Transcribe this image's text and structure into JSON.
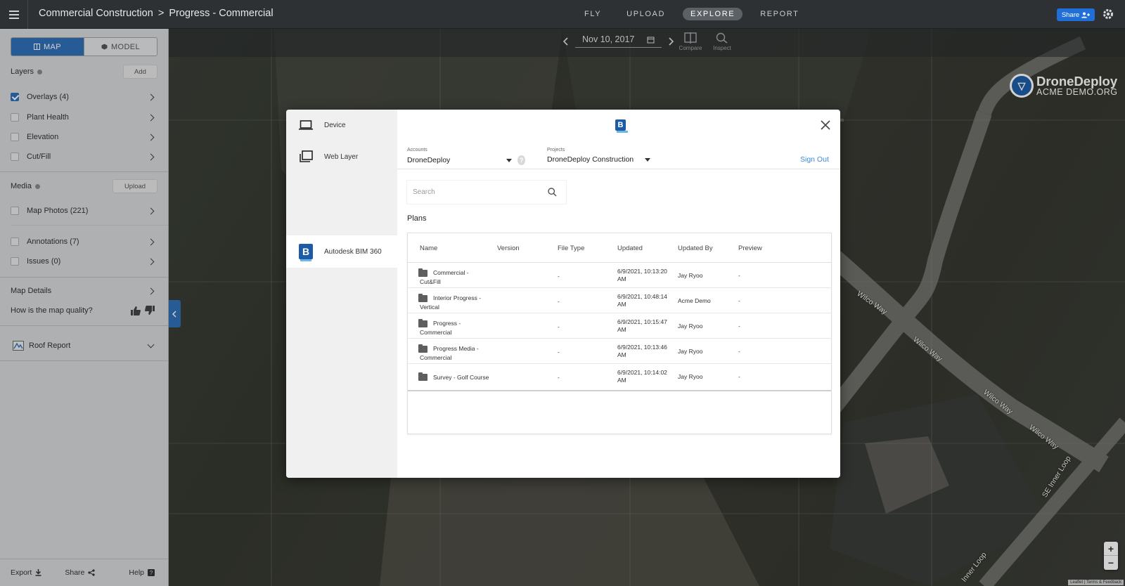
{
  "topbar": {
    "breadcrumb_project": "Commercial Construction",
    "breadcrumb_sep": ">",
    "breadcrumb_map": "Progress - Commercial",
    "tabs": [
      {
        "label": "FLY",
        "active": false
      },
      {
        "label": "UPLOAD",
        "active": false
      },
      {
        "label": "EXPLORE",
        "active": true
      },
      {
        "label": "REPORT",
        "active": false
      }
    ],
    "share_label": "Share",
    "settings_icon": "gear-icon"
  },
  "map": {
    "date": "Nov 10, 2017",
    "tools": [
      {
        "label": "Compare",
        "icon": "compare-icon"
      },
      {
        "label": "Inspect",
        "icon": "inspect-icon"
      }
    ],
    "logo_line1": "DroneDeploy",
    "logo_line2": "ACME DEMO.ORG",
    "road_labels": [
      "Wilco Way",
      "Wilco Way",
      "Wilco Way",
      "Wilco Way",
      "SE Inner Loop",
      "Inner Loop"
    ],
    "zoom_in": "+",
    "zoom_out": "−",
    "attribution": "Leaflet | Terms & Feedback"
  },
  "sidebar": {
    "mode_map": "MAP",
    "mode_model": "MODEL",
    "layers_title": "Layers",
    "layers_add": "Add",
    "layers": [
      {
        "label": "Overlays (4)",
        "checked": true
      },
      {
        "label": "Plant Health",
        "checked": false
      },
      {
        "label": "Elevation",
        "checked": false
      },
      {
        "label": "Cut/Fill",
        "checked": false
      }
    ],
    "media_title": "Media",
    "media_upload": "Upload",
    "media": [
      {
        "label": "Map Photos (221)"
      },
      {
        "label": "Annotations (7)"
      },
      {
        "label": "Issues (0)"
      }
    ],
    "map_details": "Map Details",
    "quality_question": "How is the map quality?",
    "roof_report": "Roof Report",
    "footer": {
      "export": "Export",
      "share": "Share",
      "help": "Help"
    }
  },
  "modal": {
    "sources": [
      {
        "label": "Device",
        "icon": "laptop-icon",
        "active": false
      },
      {
        "label": "Web Layer",
        "icon": "layers-icon",
        "active": false
      },
      {
        "label": "Autodesk BIM 360",
        "icon": "bim360-logo-icon",
        "active": true
      }
    ],
    "accounts_label": "Accounts",
    "accounts_value": "DroneDeploy",
    "projects_label": "Projects",
    "projects_value": "DroneDeploy Construction",
    "sign_out": "Sign Out",
    "search_placeholder": "Search",
    "plans_title": "Plans",
    "columns": [
      "Name",
      "Version",
      "File Type",
      "Updated",
      "Updated By",
      "Preview"
    ],
    "rows": [
      {
        "name1": "Commercial -",
        "name2": "Cut&Fill",
        "version": "",
        "file_type": "-",
        "updated1": "6/9/2021, 10:13:20",
        "updated2": "AM",
        "updated_by": "Jay Ryoo",
        "preview": "-"
      },
      {
        "name1": "Interior Progress -",
        "name2": "Vertical",
        "version": "",
        "file_type": "-",
        "updated1": "6/9/2021, 10:48:14",
        "updated2": "AM",
        "updated_by": "Acme Demo",
        "preview": "-"
      },
      {
        "name1": "Progress -",
        "name2": "Commercial",
        "version": "",
        "file_type": "-",
        "updated1": "6/9/2021, 10:15:47",
        "updated2": "AM",
        "updated_by": "Jay Ryoo",
        "preview": "-"
      },
      {
        "name1": "Progress Media -",
        "name2": "Commercial",
        "version": "",
        "file_type": "-",
        "updated1": "6/9/2021, 10:13:46",
        "updated2": "AM",
        "updated_by": "Jay Ryoo",
        "preview": "-"
      },
      {
        "name1": "Survey - Golf Course",
        "name2": "",
        "version": "",
        "file_type": "-",
        "updated1": "6/9/2021, 10:14:02",
        "updated2": "AM",
        "updated_by": "Jay Ryoo",
        "preview": "-"
      }
    ]
  }
}
